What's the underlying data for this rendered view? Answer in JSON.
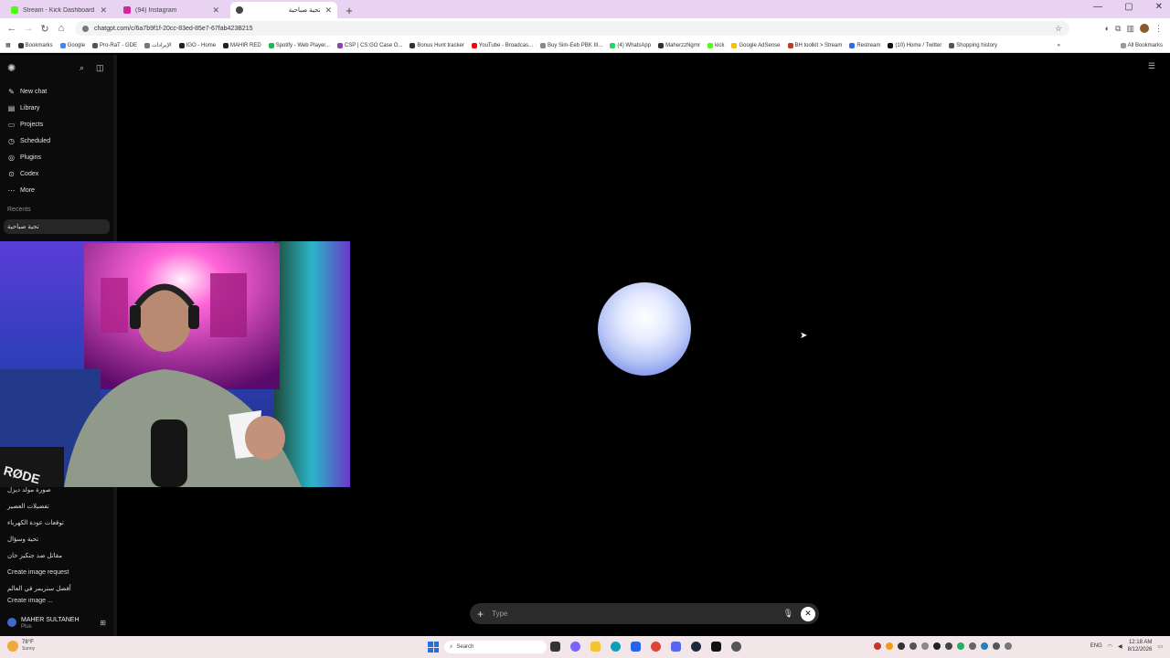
{
  "browser": {
    "tabs": [
      {
        "title": "Stream - Kick Dashboard",
        "icon": "kick-icon",
        "color": "#53fc18"
      },
      {
        "title": "(94) Instagram",
        "icon": "instagram-icon",
        "color": "#d6249f"
      },
      {
        "title": "تحية صباحية",
        "icon": "chatgpt-icon",
        "color": "#444444",
        "active": true
      }
    ],
    "url": "chatgpt.com/c/6a7b9f1f-20cc-83ed-85e7-67fab423B215",
    "bookmarks": [
      "Bookmarks",
      "Google",
      "Pro-RaT - GDE",
      "الإيرادات",
      "IGO - Home",
      "MAHIR RED",
      "Spotify - Web Player...",
      "CSP | CS:GO Case O...",
      "Bonus Hunt tracker",
      "YouTube - Broadcas...",
      "Buy Sim-Eeb PBK III...",
      "(4) WhatsApp",
      "MaherzzNgrnr",
      "kick",
      "Google AdSense",
      "BH toolkit > Stream",
      "Restream",
      "(10) Home / Twitter",
      "Shopping history"
    ],
    "all_bookmarks": "All Bookmarks"
  },
  "sidebar": {
    "nav": [
      {
        "label": "New chat",
        "icon": "compose-icon",
        "glyph": "✎"
      },
      {
        "label": "Library",
        "icon": "library-icon",
        "glyph": "▤"
      },
      {
        "label": "Projects",
        "icon": "folder-icon",
        "glyph": "▭"
      },
      {
        "label": "Scheduled",
        "icon": "clock-icon",
        "glyph": "◷"
      },
      {
        "label": "Plugins",
        "icon": "plugin-icon",
        "glyph": "◎"
      },
      {
        "label": "Codex",
        "icon": "codex-icon",
        "glyph": "⊙"
      },
      {
        "label": "More",
        "icon": "more-icon",
        "glyph": "⋯"
      }
    ],
    "recents_label": "Recents",
    "recents": [
      {
        "label": "تحية صباحية",
        "rtl": false,
        "selected": true
      },
      {
        "label": "صورة مولد ديزل",
        "rtl": true
      },
      {
        "label": "تفضيلات العصير",
        "rtl": true
      },
      {
        "label": "توقعات عودة الكهرباء",
        "rtl": true
      },
      {
        "label": "تحية وسؤال",
        "rtl": true
      },
      {
        "label": "مقاتل ضد جنكيز خان",
        "rtl": true
      },
      {
        "label": "Create image request",
        "rtl": false
      },
      {
        "label": "أفضل ستريمر في العالم",
        "rtl": true
      },
      {
        "label": "Create image ...",
        "rtl": false
      }
    ],
    "user": {
      "name": "MAHER SULTANEH",
      "plan": "Plus"
    }
  },
  "composer": {
    "placeholder": "Type"
  },
  "taskbar": {
    "weather": {
      "temp": "78°F",
      "desc": "Sunny"
    },
    "search_label": "Search",
    "lang": "ENG",
    "time": "12:18 AM",
    "date": "8/12/2026"
  }
}
